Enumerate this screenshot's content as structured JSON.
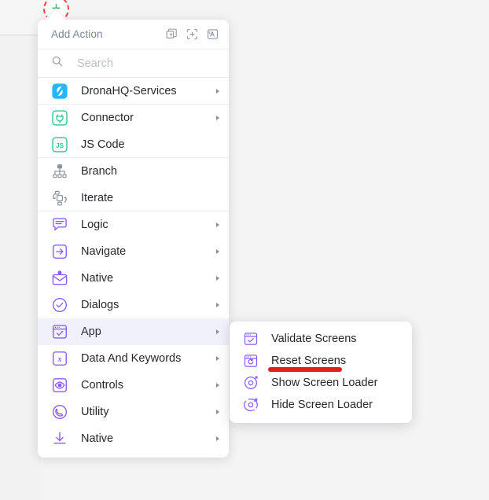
{
  "header": {
    "title": "Add Action",
    "tools": [
      {
        "name": "duplicate-add-icon",
        "tooltip": "Duplicate"
      },
      {
        "name": "select-area-add-icon",
        "tooltip": "Select"
      },
      {
        "name": "text-variable-icon",
        "tooltip": "Text"
      }
    ]
  },
  "search": {
    "placeholder": "Search",
    "value": "",
    "icon": "search-icon"
  },
  "menu": {
    "items": [
      {
        "label": "DronaHQ-Services",
        "icon": "dronahq-logo-icon",
        "icon_kind": "dronahq",
        "has_submenu": true,
        "separator_after": true,
        "active": false
      },
      {
        "label": "Connector",
        "icon": "plug-icon",
        "icon_kind": "connector",
        "has_submenu": true,
        "separator_after": false,
        "active": false
      },
      {
        "label": "JS Code",
        "icon": "js-icon",
        "icon_kind": "js",
        "has_submenu": false,
        "separator_after": true,
        "active": false
      },
      {
        "label": "Branch",
        "icon": "branch-tree-icon",
        "icon_kind": "branch",
        "has_submenu": false,
        "separator_after": false,
        "active": false
      },
      {
        "label": "Iterate",
        "icon": "loop-icon",
        "icon_kind": "iterate",
        "has_submenu": false,
        "separator_after": true,
        "active": false
      },
      {
        "label": "Logic",
        "icon": "speech-lines-icon",
        "icon_kind": "logic",
        "has_submenu": true,
        "separator_after": false,
        "active": false
      },
      {
        "label": "Navigate",
        "icon": "arrow-into-box-icon",
        "icon_kind": "navigate",
        "has_submenu": true,
        "separator_after": false,
        "active": false
      },
      {
        "label": "Native",
        "icon": "envelope-bell-icon",
        "icon_kind": "native-mail",
        "has_submenu": true,
        "separator_after": false,
        "active": false
      },
      {
        "label": "Dialogs",
        "icon": "check-circle-icon",
        "icon_kind": "dialogs",
        "has_submenu": true,
        "separator_after": false,
        "active": false
      },
      {
        "label": "App",
        "icon": "window-check-icon",
        "icon_kind": "app",
        "has_submenu": true,
        "separator_after": false,
        "active": true
      },
      {
        "label": "Data And Keywords",
        "icon": "x-variable-icon",
        "icon_kind": "data",
        "has_submenu": true,
        "separator_after": false,
        "active": false
      },
      {
        "label": "Controls",
        "icon": "eye-square-icon",
        "icon_kind": "controls",
        "has_submenu": true,
        "separator_after": false,
        "active": false
      },
      {
        "label": "Utility",
        "icon": "phone-circle-icon",
        "icon_kind": "utility",
        "has_submenu": true,
        "separator_after": false,
        "active": false
      },
      {
        "label": "Native",
        "icon": "download-icon",
        "icon_kind": "native-dl",
        "has_submenu": true,
        "separator_after": false,
        "active": false
      }
    ]
  },
  "submenu": {
    "parent": "App",
    "items": [
      {
        "label": "Validate Screens",
        "icon": "window-check-icon",
        "icon_kind": "validate"
      },
      {
        "label": "Reset Screens",
        "icon": "window-reset-icon",
        "icon_kind": "reset"
      },
      {
        "label": "Show Screen Loader",
        "icon": "loader-show-icon",
        "icon_kind": "show-loader"
      },
      {
        "label": "Hide Screen Loader",
        "icon": "loader-hide-icon",
        "icon_kind": "hide-loader"
      }
    ]
  },
  "annotation": {
    "type": "underline",
    "target": "Reset Screens",
    "color": "#e02020"
  },
  "add_button": {
    "glyph": "+",
    "glyph_color": "#2fbf71",
    "ring_color": "#e8483f"
  },
  "colors": {
    "accent_purple": "#8b5cf6",
    "accent_green": "#34c38f",
    "accent_blue": "#29b6f6",
    "active_row_bg": "#f1f1fb",
    "menu_bg": "#ffffff",
    "page_bg": "#f4f4f5",
    "text": "#24292f",
    "muted_text": "#7a8794"
  }
}
